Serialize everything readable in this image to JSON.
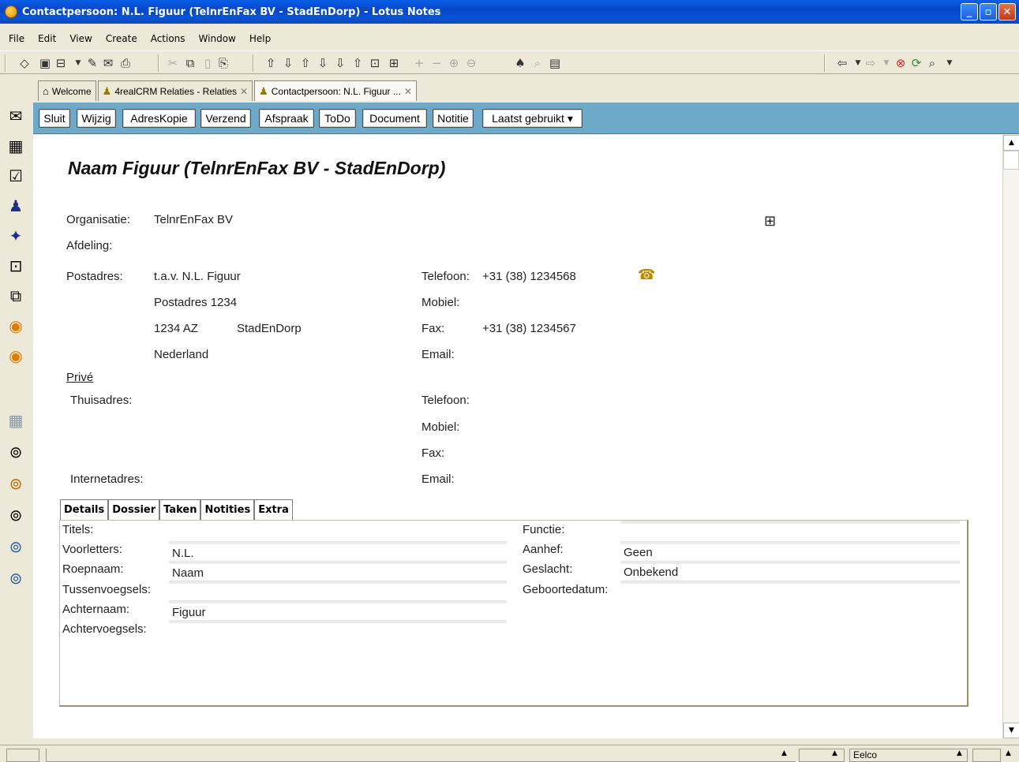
{
  "window": {
    "title": "Contactpersoon: N.L. Figuur (TelnrEnFax BV - StadEnDorp) - Lotus Notes",
    "minimize": "_",
    "restore": "▫",
    "close": "✕"
  },
  "menu": [
    "File",
    "Edit",
    "View",
    "Create",
    "Actions",
    "Window",
    "Help"
  ],
  "tabs": [
    {
      "label": "Welcome",
      "icon": "home-icon"
    },
    {
      "label": "4realCRM Relaties - Relaties",
      "icon": "people-icon"
    },
    {
      "label": "Contactpersoon: N.L. Figuur ...",
      "icon": "contact-icon"
    }
  ],
  "actions": [
    "Sluit",
    "Wijzig",
    "AdresKopie",
    "Verzend",
    "Afspraak",
    "ToDo",
    "Document",
    "Notitie",
    "Laatst gebruikt ▾"
  ],
  "doc": {
    "title": "Naam Figuur (TelnrEnFax BV - StadEnDorp)",
    "organisatie_label": "Organisatie:",
    "organisatie_value": "TelnrEnFax BV",
    "afdeling_label": "Afdeling:",
    "postadres_label": "Postadres:",
    "postadres_lines": [
      "t.a.v. N.L. Figuur",
      "Postadres 1234",
      "1234 AZ",
      "StadEnDorp",
      "Nederland"
    ],
    "telefoon_label": "Telefoon:",
    "telefoon_value": "+31 (38) 1234568",
    "mobiel_label": "Mobiel:",
    "fax_label": "Fax:",
    "fax_value": "+31 (38) 1234567",
    "email_label": "Email:",
    "prive_label": "Privé",
    "thuisadres_label": "Thuisadres:",
    "internetadres_label": "Internetadres:",
    "prive_telefoon_label": "Telefoon:",
    "prive_mobiel_label": "Mobiel:",
    "prive_fax_label": "Fax:",
    "prive_email_label": "Email:"
  },
  "subtabs": [
    "Details",
    "Dossier",
    "Taken",
    "Notities",
    "Extra"
  ],
  "details": {
    "titels_label": "Titels:",
    "voorletters_label": "Voorletters:",
    "voorletters_value": "N.L.",
    "roepnaam_label": "Roepnaam:",
    "roepnaam_value": "Naam",
    "tussenvoegsels_label": "Tussenvoegsels:",
    "achternaam_label": "Achternaam:",
    "achternaam_value": "Figuur",
    "achtervoegsels_label": "Achtervoegsels:",
    "functie_label": "Functie:",
    "aanhef_label": "Aanhef:",
    "aanhef_value": "Geen",
    "geslacht_label": "Geslacht:",
    "geslacht_value": "Onbekend",
    "geboortedatum_label": "Geboortedatum:"
  },
  "status": {
    "location": "Eelco"
  }
}
